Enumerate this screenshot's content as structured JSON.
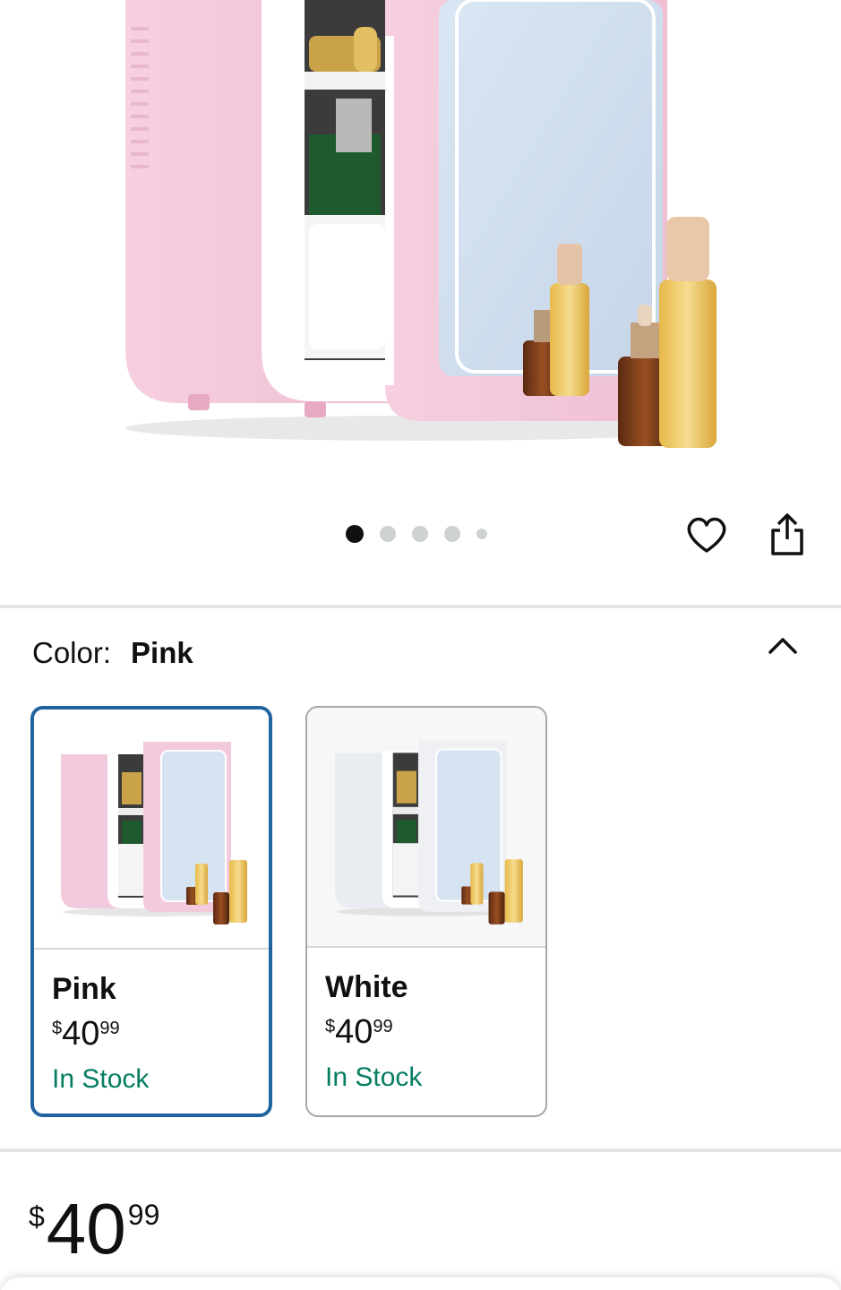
{
  "product_image": {
    "alt": "Pink mini fridge with mirror door",
    "carousel": {
      "total": 5,
      "active_index": 0
    }
  },
  "actions": {
    "favorite_icon": "heart-icon",
    "share_icon": "share-icon"
  },
  "variation": {
    "label": "Color:",
    "selected_value": "Pink",
    "toggle_icon": "chevron-up-icon",
    "options": [
      {
        "name": "Pink",
        "price_symbol": "$",
        "price_whole": "40",
        "price_fraction": "99",
        "availability": "In Stock",
        "selected": true,
        "body_color": "#f3c9dd"
      },
      {
        "name": "White",
        "price_symbol": "$",
        "price_whole": "40",
        "price_fraction": "99",
        "availability": "In Stock",
        "selected": false,
        "body_color": "#eef0f3"
      }
    ]
  },
  "price": {
    "symbol": "$",
    "whole": "40",
    "fraction": "99"
  },
  "colors": {
    "selected_border": "#2162a1",
    "in_stock": "#067d62",
    "active_dot": "#0f1111",
    "inactive_dot": "#cfd2d3"
  }
}
